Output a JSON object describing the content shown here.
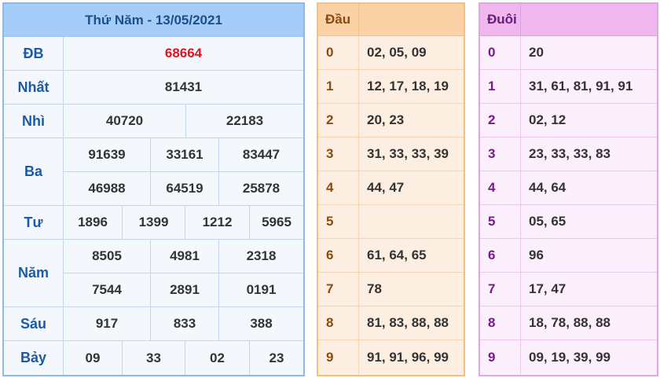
{
  "results": {
    "title": "Thứ Năm - 13/05/2021",
    "rows": [
      {
        "label": "ĐB",
        "lines": [
          [
            "68664"
          ]
        ]
      },
      {
        "label": "Nhất",
        "lines": [
          [
            "81431"
          ]
        ]
      },
      {
        "label": "Nhì",
        "lines": [
          [
            "40720",
            "22183"
          ]
        ]
      },
      {
        "label": "Ba",
        "lines": [
          [
            "91639",
            "33161",
            "83447"
          ],
          [
            "46988",
            "64519",
            "25878"
          ]
        ]
      },
      {
        "label": "Tư",
        "lines": [
          [
            "1896",
            "1399",
            "1212",
            "5965"
          ]
        ]
      },
      {
        "label": "Năm",
        "lines": [
          [
            "8505",
            "4981",
            "2318"
          ],
          [
            "7544",
            "2891",
            "0191"
          ]
        ]
      },
      {
        "label": "Sáu",
        "lines": [
          [
            "917",
            "833",
            "388"
          ]
        ]
      },
      {
        "label": "Bảy",
        "lines": [
          [
            "09",
            "33",
            "02",
            "23"
          ]
        ]
      }
    ]
  },
  "dau": {
    "header": "Đầu",
    "rows": [
      {
        "key": "0",
        "values": "02, 05, 09"
      },
      {
        "key": "1",
        "values": "12, 17, 18, 19"
      },
      {
        "key": "2",
        "values": "20, 23"
      },
      {
        "key": "3",
        "values": "31, 33, 33, 39"
      },
      {
        "key": "4",
        "values": "44, 47"
      },
      {
        "key": "5",
        "values": ""
      },
      {
        "key": "6",
        "values": "61, 64, 65"
      },
      {
        "key": "7",
        "values": "78"
      },
      {
        "key": "8",
        "values": "81, 83, 88, 88"
      },
      {
        "key": "9",
        "values": "91, 91, 96, 99"
      }
    ]
  },
  "duoi": {
    "header": "Đuôi",
    "rows": [
      {
        "key": "0",
        "values": "20"
      },
      {
        "key": "1",
        "values": "31, 61, 81, 91, 91"
      },
      {
        "key": "2",
        "values": "02, 12"
      },
      {
        "key": "3",
        "values": "23, 33, 33, 83"
      },
      {
        "key": "4",
        "values": "44, 64"
      },
      {
        "key": "5",
        "values": "05, 65"
      },
      {
        "key": "6",
        "values": "96"
      },
      {
        "key": "7",
        "values": "17, 47"
      },
      {
        "key": "8",
        "values": "18, 78, 88, 88"
      },
      {
        "key": "9",
        "values": "09, 19, 39, 99"
      }
    ]
  },
  "colors": {
    "special_prize": "#e0141e",
    "label_blue": "#1a5aa6",
    "dau_accent": "#f5bf80",
    "duoi_accent": "#e2a6e4"
  }
}
